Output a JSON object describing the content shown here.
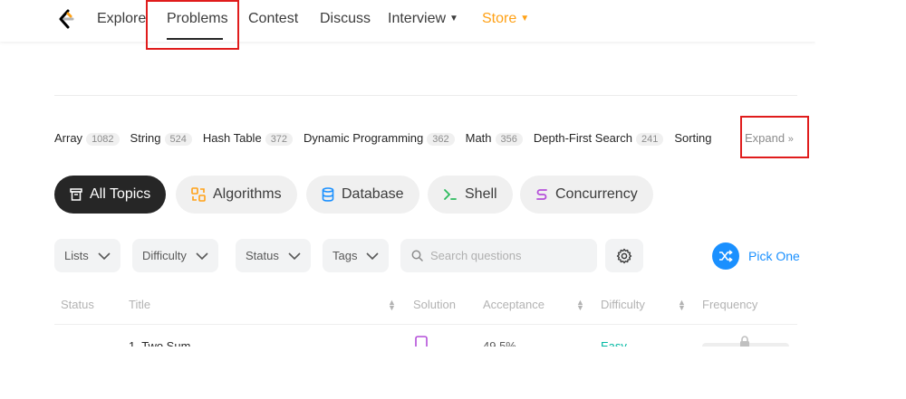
{
  "nav": {
    "logo_icon": "leetcode-logo-icon",
    "items": [
      {
        "label": "Explore"
      },
      {
        "label": "Problems",
        "active": true
      },
      {
        "label": "Contest"
      },
      {
        "label": "Discuss"
      },
      {
        "label": "Interview",
        "has_dropdown": true
      },
      {
        "label": "Store",
        "has_dropdown": true,
        "color": "#ffa116"
      }
    ]
  },
  "tags": [
    {
      "name": "Array",
      "count": "1082"
    },
    {
      "name": "String",
      "count": "524"
    },
    {
      "name": "Hash Table",
      "count": "372"
    },
    {
      "name": "Dynamic Programming",
      "count": "362"
    },
    {
      "name": "Math",
      "count": "356"
    },
    {
      "name": "Depth-First Search",
      "count": "241"
    },
    {
      "name": "Sorting",
      "count": ""
    }
  ],
  "expand_label": "Expand",
  "topics": [
    {
      "label": "All Topics",
      "active": true,
      "icon": "list-icon"
    },
    {
      "label": "Algorithms",
      "icon": "algorithms-icon",
      "color": "#ffa116"
    },
    {
      "label": "Database",
      "icon": "database-icon",
      "color": "#1a90ff"
    },
    {
      "label": "Shell",
      "icon": "shell-icon",
      "color": "#2cbb5d"
    },
    {
      "label": "Concurrency",
      "icon": "concurrency-icon",
      "color": "#b44fd9"
    }
  ],
  "filters": {
    "lists": "Lists",
    "difficulty": "Difficulty",
    "status": "Status",
    "tags": "Tags",
    "search_placeholder": "Search questions",
    "pick_one": "Pick One"
  },
  "table": {
    "headers": {
      "status": "Status",
      "title": "Title",
      "solution": "Solution",
      "acceptance": "Acceptance",
      "difficulty": "Difficulty",
      "frequency": "Frequency"
    },
    "rows": [
      {
        "status": "—",
        "title": "1. Two Sum",
        "acceptance": "49.5%",
        "difficulty": "Easy"
      }
    ]
  },
  "colors": {
    "accent_blue": "#1a90ff",
    "store_orange": "#ffa116",
    "easy_green": "#00b8a3",
    "highlight_red": "#e01c1c"
  }
}
